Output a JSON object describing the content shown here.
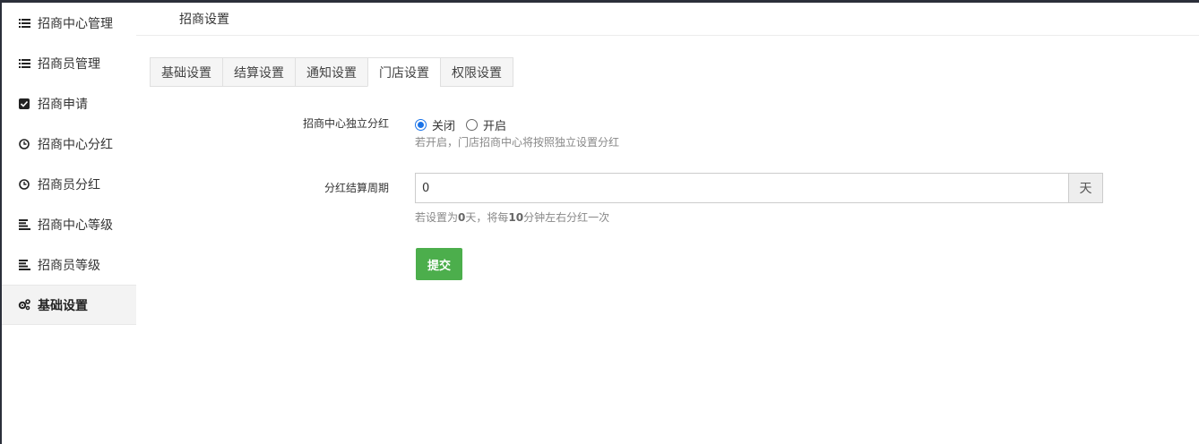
{
  "sidebar": {
    "items": [
      {
        "label": "招商中心管理",
        "icon": "list-icon"
      },
      {
        "label": "招商员管理",
        "icon": "list-icon"
      },
      {
        "label": "招商申请",
        "icon": "checkbox-icon"
      },
      {
        "label": "招商中心分红",
        "icon": "clock-icon"
      },
      {
        "label": "招商员分红",
        "icon": "clock-icon"
      },
      {
        "label": "招商中心等级",
        "icon": "align-left-icon"
      },
      {
        "label": "招商员等级",
        "icon": "align-left-icon"
      },
      {
        "label": "基础设置",
        "icon": "gears-icon",
        "active": true
      }
    ]
  },
  "header": {
    "title": "招商设置"
  },
  "tabs": [
    {
      "label": "基础设置"
    },
    {
      "label": "结算设置"
    },
    {
      "label": "通知设置"
    },
    {
      "label": "门店设置",
      "active": true
    },
    {
      "label": "权限设置"
    }
  ],
  "form": {
    "independent": {
      "label": "招商中心独立分红",
      "options": [
        "关闭",
        "开启"
      ],
      "selected": "关闭",
      "help": "若开启，门店招商中心将按照独立设置分红"
    },
    "period": {
      "label": "分红结算周期",
      "value": "0",
      "unit": "天",
      "help_prefix": "若设置为",
      "help_days": "0",
      "help_mid": "天，将每",
      "help_minutes": "10",
      "help_suffix": "分钟左右分红一次"
    },
    "submit_label": "提交"
  },
  "colors": {
    "accent_blue": "#1a73e8",
    "submit_green": "#4cae4c"
  }
}
